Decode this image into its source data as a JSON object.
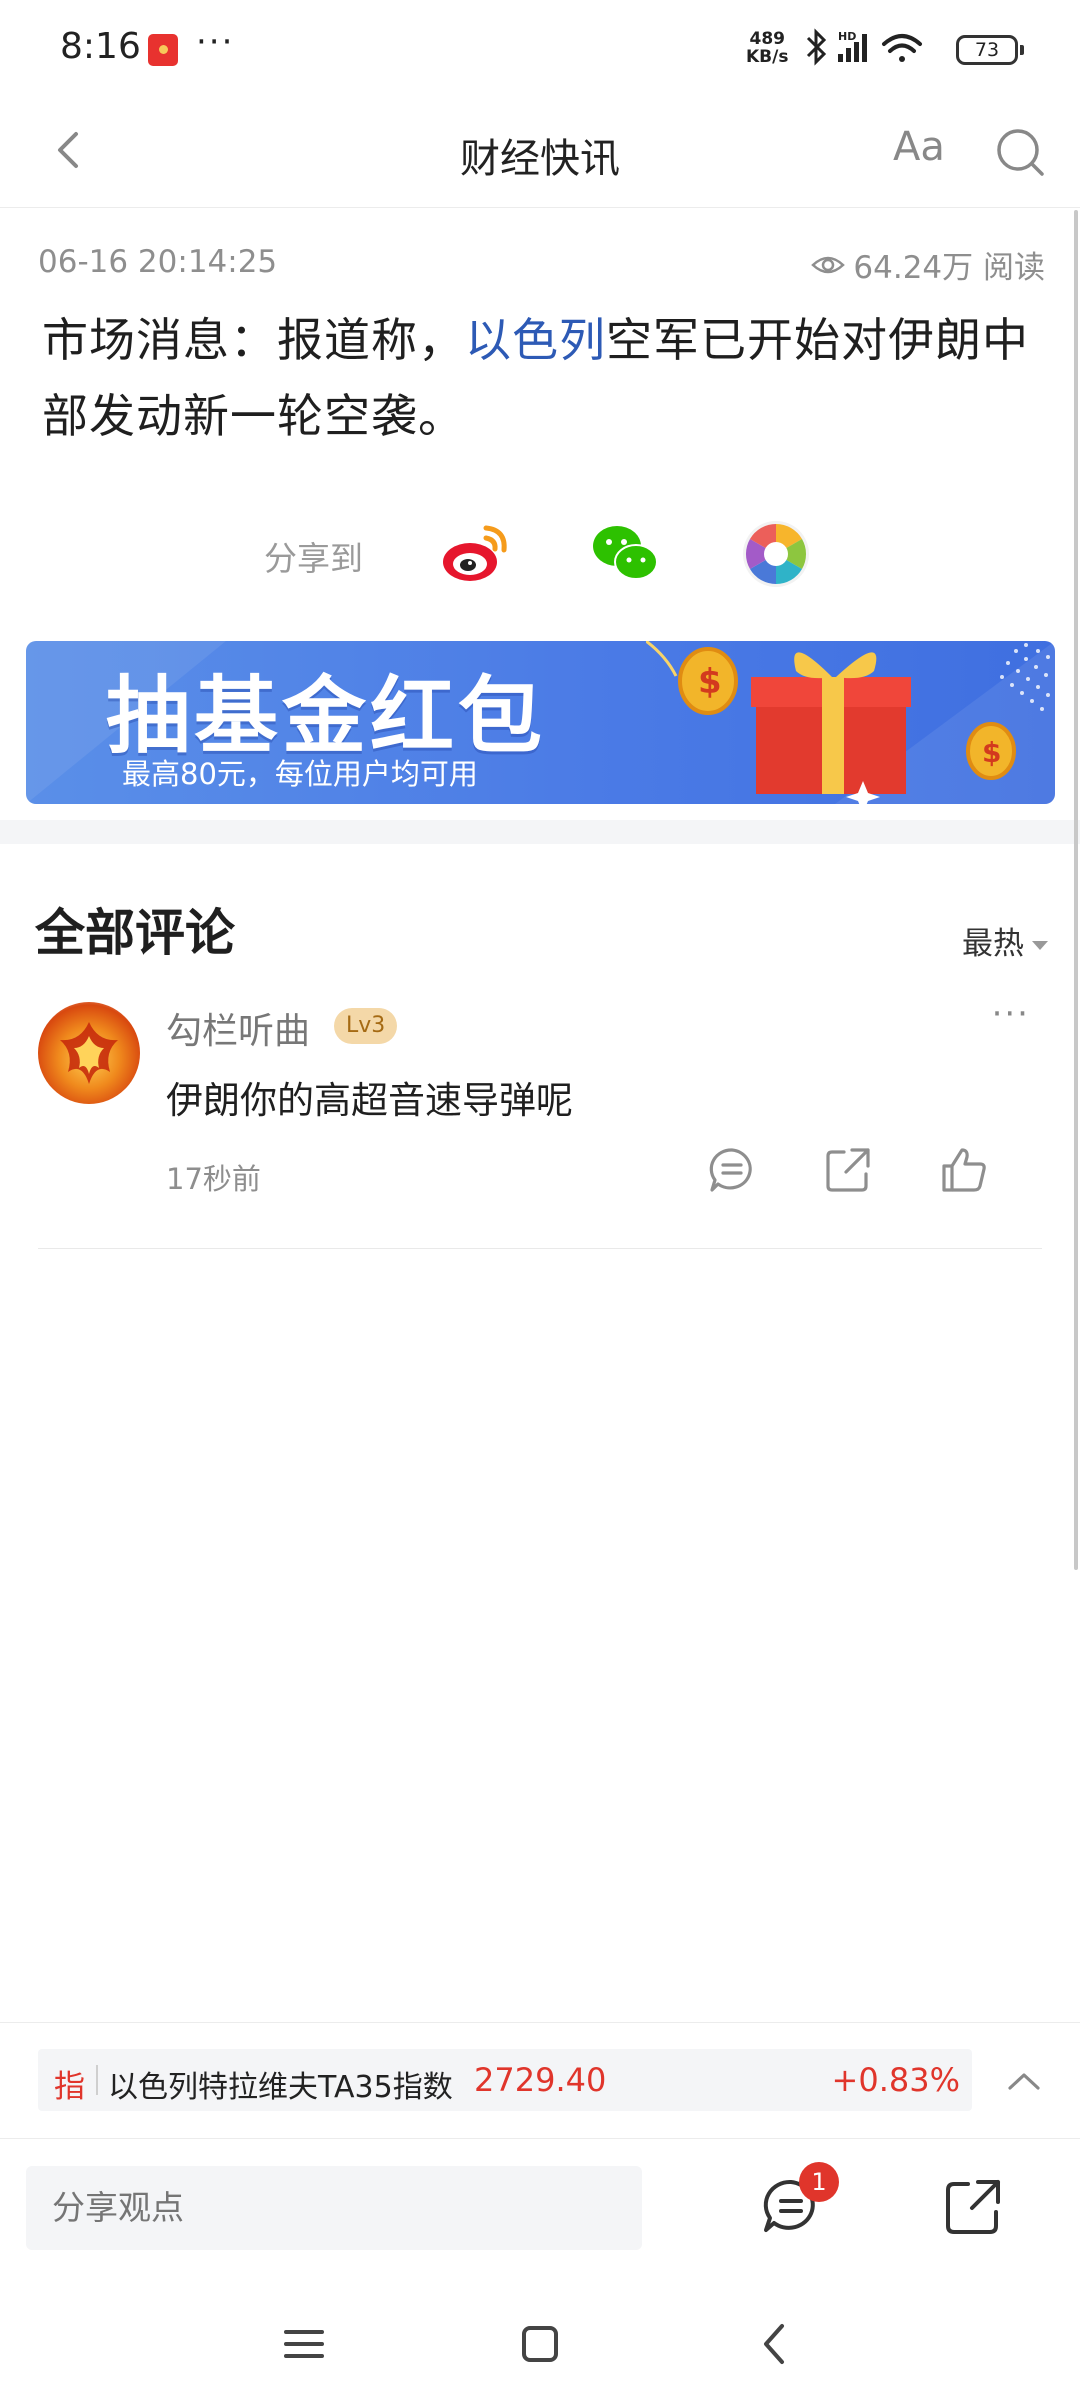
{
  "status_bar": {
    "time": "8:16",
    "more": "···",
    "net_speed_value": "489",
    "net_speed_unit": "KB/s",
    "battery": "73"
  },
  "header": {
    "title": "财经快讯",
    "font_size_label": "Aa"
  },
  "article": {
    "timestamp": "06-16 20:14:25",
    "reads": "64.24万 阅读",
    "body_before": "市场消息：报道称，",
    "body_highlight": "以色列",
    "body_after": "空军已开始对伊朗中部发动新一轮空袭。",
    "highlight_color": "#2d5ab5"
  },
  "share": {
    "label": "分享到",
    "targets": [
      "weibo-icon",
      "wechat-icon",
      "moments-icon"
    ]
  },
  "banner": {
    "title": "抽基金红包",
    "subtitle": "最高80元，每位用户均可用"
  },
  "comments": {
    "section_title": "全部评论",
    "sort_label": "最热",
    "items": [
      {
        "user": "勾栏听曲",
        "level": "Lv3",
        "text": "伊朗你的高超音速导弹呢",
        "time": "17秒前"
      }
    ]
  },
  "stock": {
    "tag": "指",
    "name": "以色列特拉维夫TA35指数",
    "price": "2729.40",
    "change": "+0.83%",
    "color": "#e0352b"
  },
  "bottom_bar": {
    "input_placeholder": "分享观点",
    "comment_count": "1"
  }
}
